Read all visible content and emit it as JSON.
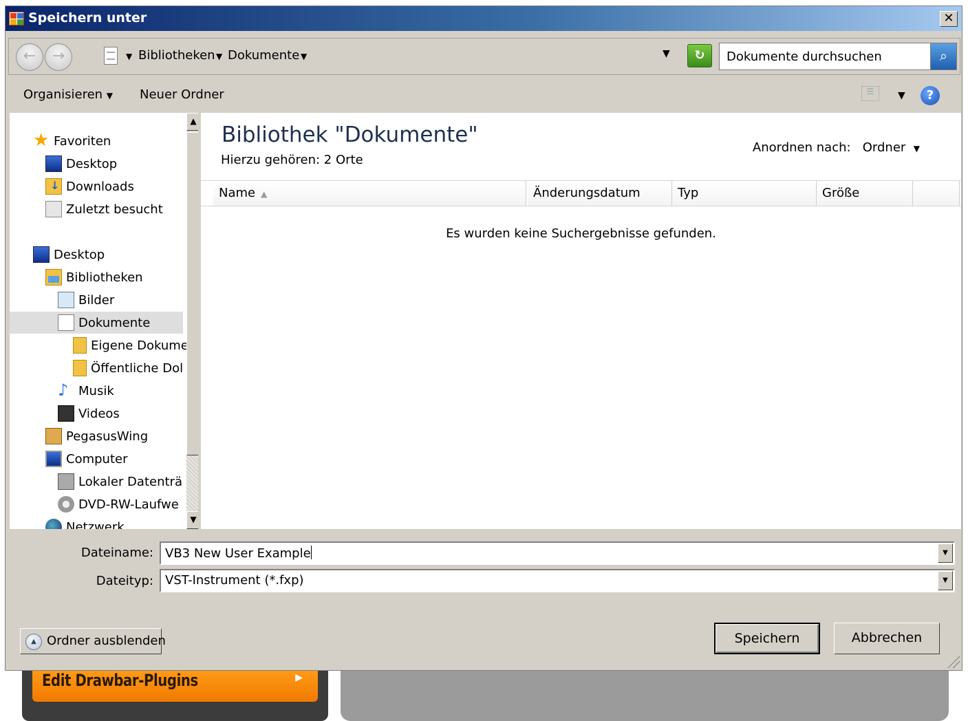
{
  "background_app": {
    "orange_button_label": "Edit Drawbar-Plugins"
  },
  "dialog": {
    "title": "Speichern unter",
    "close_glyph": "✕",
    "address": {
      "crumbs": [
        "Bibliotheken",
        "Dokumente"
      ]
    },
    "search": {
      "placeholder": "Dokumente durchsuchen"
    },
    "toolbar": {
      "organize": "Organisieren",
      "new_folder": "Neuer Ordner"
    },
    "nav": {
      "favorites": "Favoriten",
      "desktop_fav": "Desktop",
      "downloads": "Downloads",
      "recent": "Zuletzt besucht",
      "desktop": "Desktop",
      "libraries": "Bibliotheken",
      "pictures": "Bilder",
      "documents": "Dokumente",
      "my_documents": "Eigene Dokume",
      "public_documents": "Öffentliche Dol",
      "music": "Musik",
      "videos": "Videos",
      "user": "PegasusWing",
      "computer": "Computer",
      "local_disk": "Lokaler Datenträ",
      "dvd": "DVD-RW-Laufwe",
      "network": "Netzwerk"
    },
    "content": {
      "library_title": "Bibliothek \"Dokumente\"",
      "subtitle": "Hierzu gehören:  2 Orte",
      "arrange_label": "Anordnen nach:",
      "arrange_value": "Ordner",
      "columns": [
        "Name",
        "Änderungsdatum",
        "Typ",
        "Größe"
      ],
      "empty_message": "Es wurden keine Suchergebnisse gefunden."
    },
    "filename_label": "Dateiname:",
    "filename_value": "VB3 New User Example",
    "filetype_label": "Dateityp:",
    "filetype_value": "VST-Instrument (*.fxp)",
    "hide_folders": "Ordner ausblenden",
    "save": "Speichern",
    "cancel": "Abbrechen"
  }
}
